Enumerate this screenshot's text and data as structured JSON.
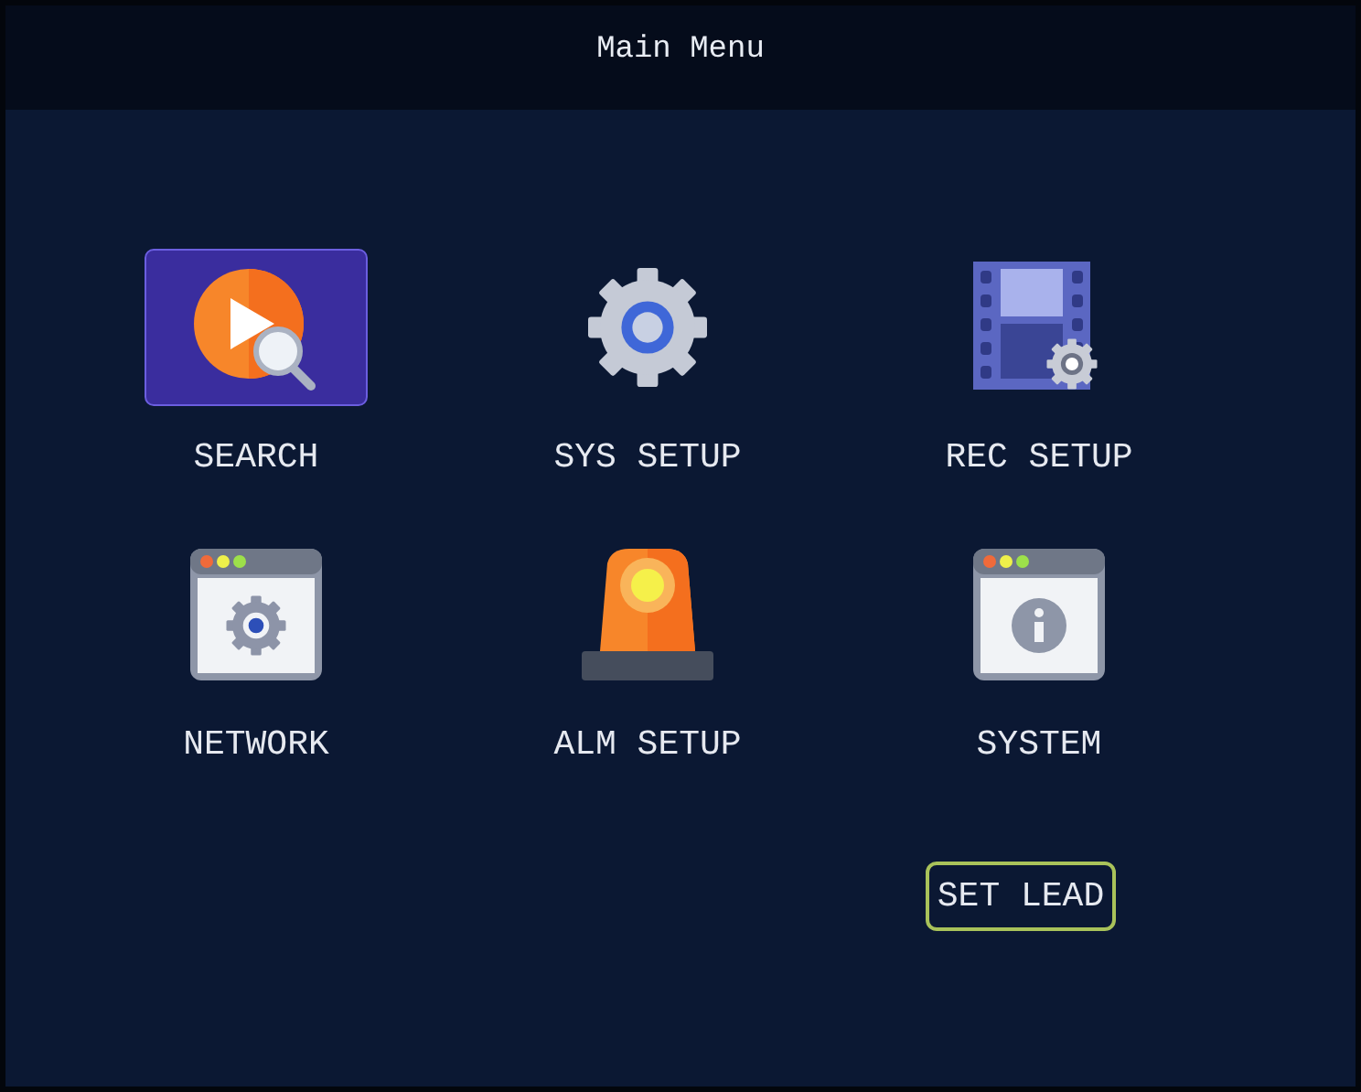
{
  "window": {
    "title": "Main Menu"
  },
  "menu_items": [
    {
      "label": "SEARCH",
      "kind": "search",
      "selected": true
    },
    {
      "label": "SYS SETUP",
      "kind": "gear",
      "selected": false
    },
    {
      "label": "REC SETUP",
      "kind": "film",
      "selected": false
    },
    {
      "label": "NETWORK",
      "kind": "network",
      "selected": false
    },
    {
      "label": "ALM SETUP",
      "kind": "alarm",
      "selected": false
    },
    {
      "label": "SYSTEM",
      "kind": "info",
      "selected": false
    }
  ],
  "button": {
    "label": "SET LEAD"
  }
}
